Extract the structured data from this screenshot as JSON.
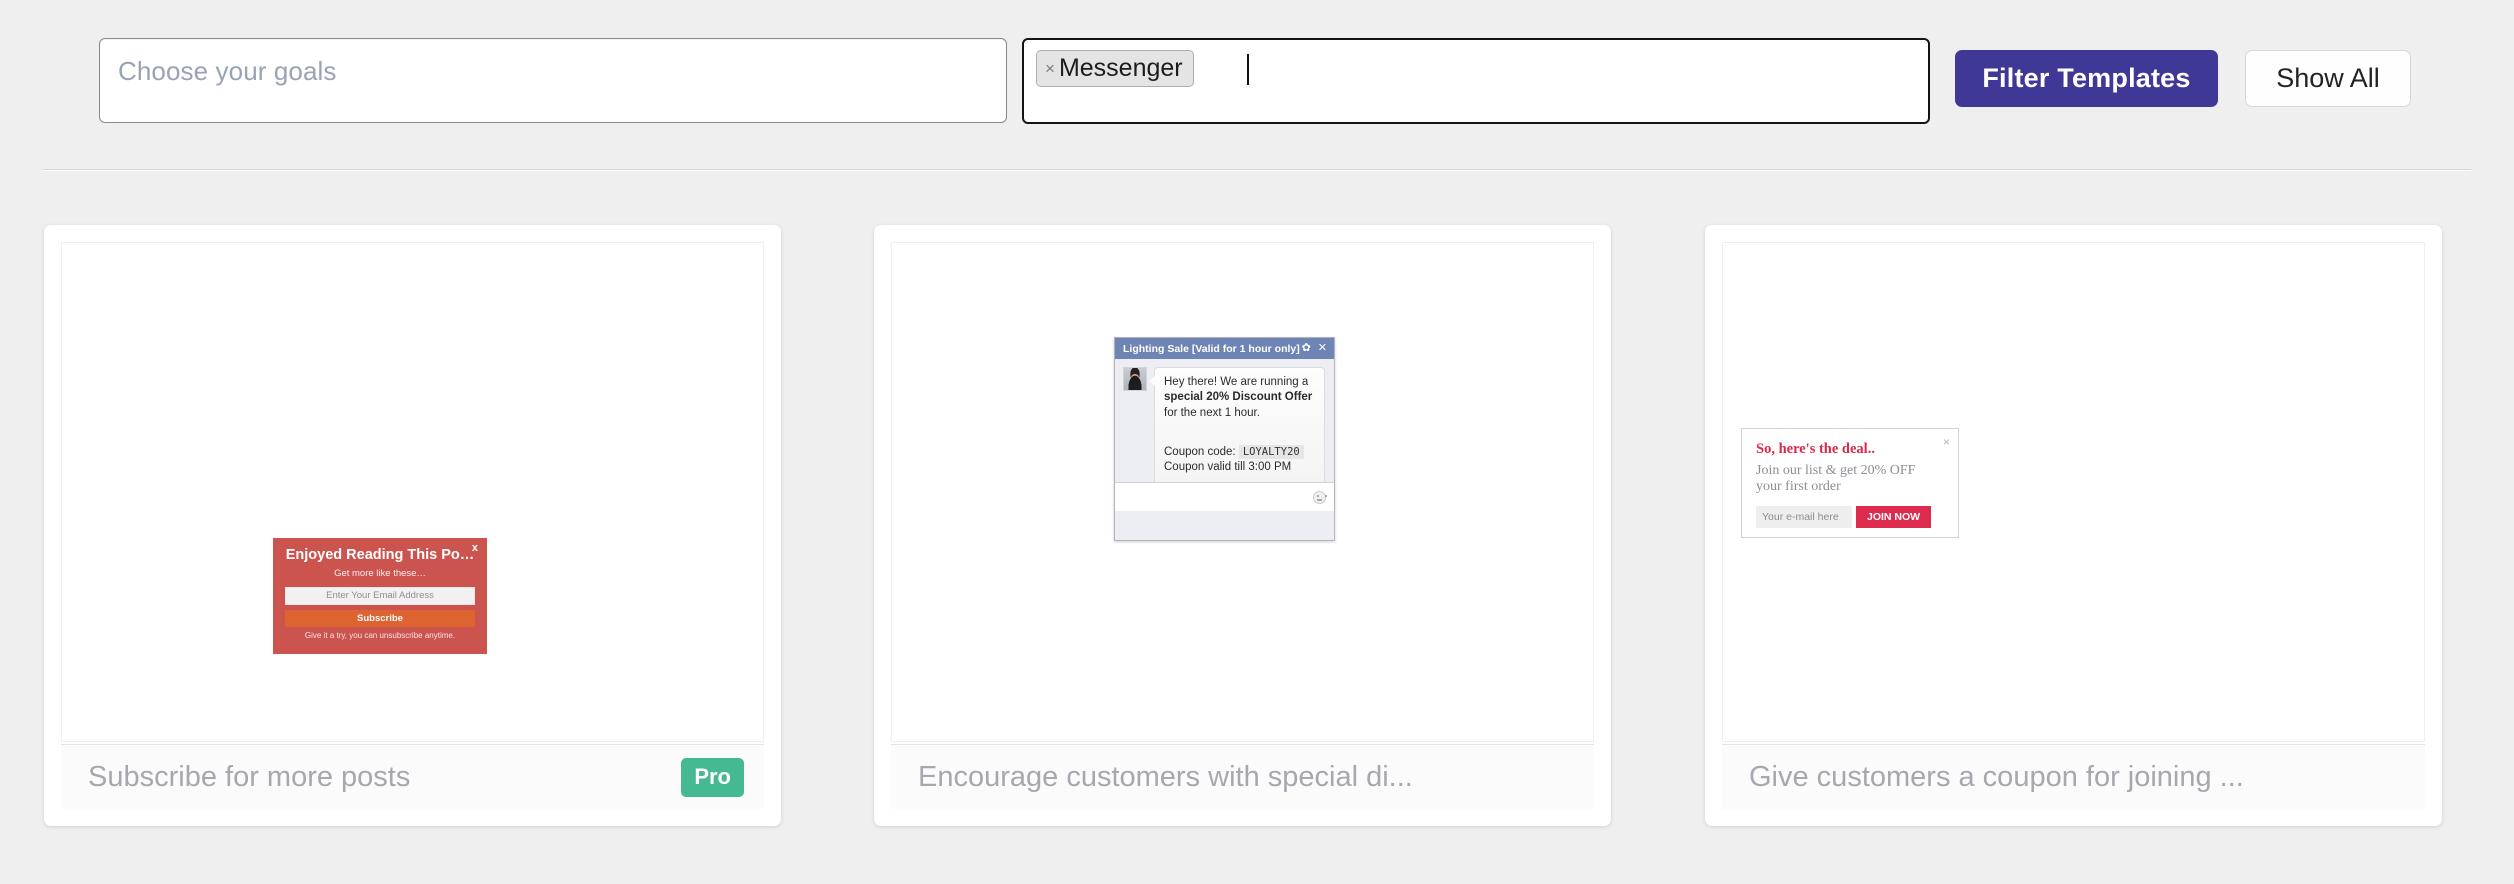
{
  "toolbar": {
    "goals_placeholder": "Choose your goals",
    "channel_token": "Messenger",
    "channel_token_remove": "×",
    "filter_button": "Filter Templates",
    "show_all_button": "Show All"
  },
  "cards": [
    {
      "caption": "Subscribe for more posts",
      "badge": "Pro",
      "popup": {
        "type": "red-subscribe",
        "close": "x",
        "title": "Enjoyed Reading This Po…",
        "subtitle": "Get more like these…",
        "email_placeholder": "Enter Your Email Address",
        "submit": "Subscribe",
        "note": "Give it a try, you can unsubscribe anytime."
      }
    },
    {
      "caption": "Encourage customers with special di...",
      "badge": "",
      "popup": {
        "type": "messenger",
        "header_title": "Lighting Sale [Valid for 1 hour only]",
        "gear": "✿",
        "close": "✕",
        "message_part1": "Hey there! We are running a ",
        "message_bold": "special 20% Discount Offer",
        "message_part2": " for the next 1 hour.",
        "coupon_label": "Coupon code:",
        "coupon_code": "LOYALTY20",
        "coupon_valid": "Coupon valid till 3:00 PM"
      }
    },
    {
      "caption": "Give customers a coupon for joining ...",
      "badge": "",
      "popup": {
        "type": "serif-coupon",
        "close": "×",
        "title": "So, here's the deal..",
        "subtitle": "Join our list & get 20% OFF your first order",
        "email_placeholder": "Your e-mail here",
        "submit": "JOIN NOW"
      }
    }
  ],
  "colors": {
    "page_bg": "#efefef",
    "accent_purple": "#3f3896",
    "pro_green": "#45b991",
    "popup_red": "#cc544f",
    "subscribe_orange": "#dd6331",
    "messenger_blue": "#6d84b4",
    "join_red": "#dd2b4e"
  }
}
